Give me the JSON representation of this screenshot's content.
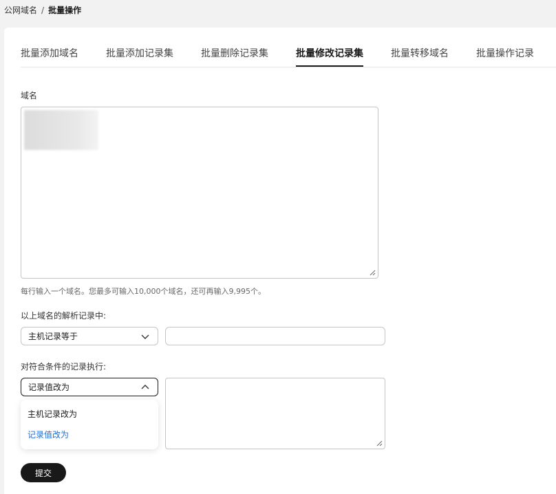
{
  "breadcrumb": {
    "parent": "公网域名",
    "separator": "/",
    "current": "批量操作"
  },
  "tabs": [
    {
      "label": "批量添加域名",
      "active": false
    },
    {
      "label": "批量添加记录集",
      "active": false
    },
    {
      "label": "批量删除记录集",
      "active": false
    },
    {
      "label": "批量修改记录集",
      "active": true
    },
    {
      "label": "批量转移域名",
      "active": false
    },
    {
      "label": "批量操作记录",
      "active": false
    }
  ],
  "domain_field": {
    "label": "域名",
    "hint": "每行输入一个域名。您最多可输入10,000个域名，还可再输入9,995个。"
  },
  "condition": {
    "label": "以上域名的解析记录中:",
    "select_value": "主机记录等于",
    "input_value": ""
  },
  "action": {
    "label": "对符合条件的记录执行:",
    "select_value": "记录值改为",
    "textarea_value": "",
    "options": [
      {
        "label": "主机记录改为",
        "selected": false
      },
      {
        "label": "记录值改为",
        "selected": true
      }
    ]
  },
  "submit_label": "提交",
  "colors": {
    "primary": "#191919",
    "selected_option": "#1d6fd8",
    "border": "#c4c4c4"
  }
}
